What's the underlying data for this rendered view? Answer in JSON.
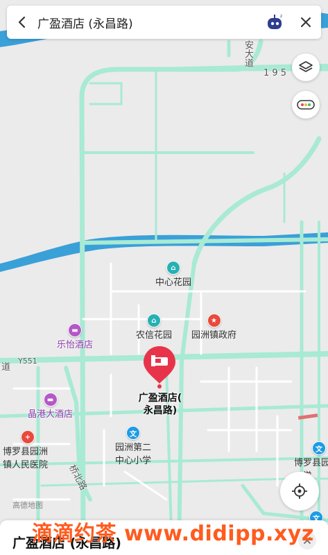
{
  "header": {
    "title": "广盈酒店 (永昌路)"
  },
  "map": {
    "pois": [
      {
        "name": "中心花园",
        "type": "park"
      },
      {
        "name": "农信花园",
        "type": "residential"
      },
      {
        "name": "园洲镇政府",
        "type": "government"
      },
      {
        "name": "乐怡酒店",
        "type": "hotel"
      },
      {
        "name": "晶港大酒店",
        "type": "hotel"
      },
      {
        "name": "博罗县园洲镇人民医院",
        "line1": "博罗县园洲",
        "line2": "镇人民医院",
        "type": "hospital"
      },
      {
        "name": "园洲第二中心小学",
        "line1": "园洲第二",
        "line2": "中心小学",
        "type": "school"
      },
      {
        "name": "博罗县...学",
        "line1": "博罗县园",
        "line2": "...学",
        "type": "school"
      }
    ],
    "roads": {
      "road_east": "安大道",
      "road_195": "1 9 5",
      "y551": "Y551",
      "dao": "道",
      "qiaobei": "桥北路"
    },
    "selected": {
      "line1": "广盈酒店(",
      "line2": "永昌路)"
    },
    "provider": "高德地图"
  },
  "bottom_card": {
    "title": "广盈酒店 (永昌路)"
  },
  "watermark": "滴滴约茶 www.didipp.xyz",
  "colors": {
    "road": "#a8ead4",
    "water": "#3aa0d8",
    "marker": "#e8344a",
    "background": "#ebebeb"
  }
}
